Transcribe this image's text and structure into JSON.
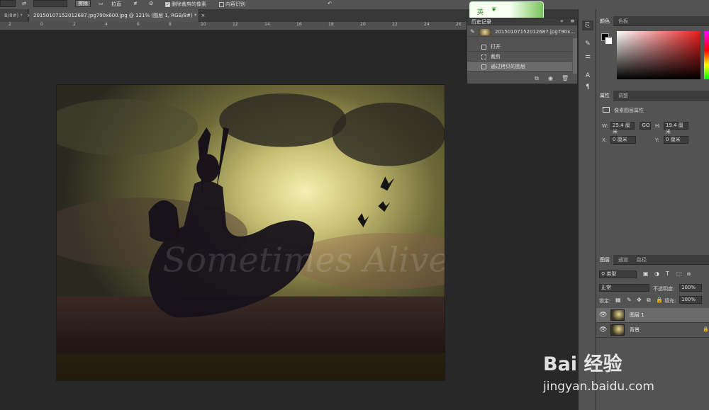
{
  "options_bar": {
    "left_label": "B/8#)",
    "straighten_label": "拉直",
    "delete_cropped_label": "删除裁剪的像素",
    "delete_cropped_checked": true,
    "content_aware_label": "内容识别",
    "content_aware_checked": false,
    "erase_button": "擦除"
  },
  "tabs": [
    {
      "label": "B/8#) *",
      "active": false
    },
    {
      "label": "20150107152012687.jpg790x600.jpg @ 121% (图层 1, RGB/8#) *",
      "active": true
    }
  ],
  "ruler": {
    "ticks": [
      "2",
      "0",
      "2",
      "4",
      "6",
      "8",
      "10",
      "12",
      "14",
      "16",
      "18",
      "20",
      "22",
      "24",
      "26"
    ]
  },
  "history_panel": {
    "title": "历史记录",
    "snapshot": "20150107152012687.jpg790x...",
    "items": [
      {
        "label": "打开",
        "selected": false
      },
      {
        "label": "裁剪",
        "selected": false
      },
      {
        "label": "通过拷贝的图层",
        "selected": true
      }
    ]
  },
  "color_panel": {
    "tabs": [
      "颜色",
      "色板"
    ],
    "foreground": "#000000",
    "background": "#ffffff"
  },
  "properties_panel": {
    "tabs": [
      "属性",
      "调整"
    ],
    "title": "像素图层属性",
    "w_label": "W:",
    "w_value": "25.4 厘米",
    "h_label": "H:",
    "h_value": "19.4 厘米",
    "x_label": "X:",
    "x_value": "0 厘米",
    "y_label": "Y:",
    "y_value": "0 厘米",
    "link_symbol": "GO"
  },
  "layers_panel": {
    "tabs": [
      "图层",
      "通道",
      "路径"
    ],
    "filter_kind": "类型",
    "blend_mode": "正常",
    "opacity_label": "不透明度:",
    "opacity_value": "100%",
    "lock_label": "锁定:",
    "fill_label": "填充:",
    "fill_value": "100%",
    "layers": [
      {
        "name": "图层 1",
        "selected": true
      },
      {
        "name": "背景",
        "selected": false
      }
    ]
  },
  "ime_widget": {
    "label": "英"
  },
  "photo": {
    "script_text": "Sometimes Alive"
  },
  "watermark": {
    "brand": "Bai 经验",
    "url": "jingyan.baidu.com"
  }
}
